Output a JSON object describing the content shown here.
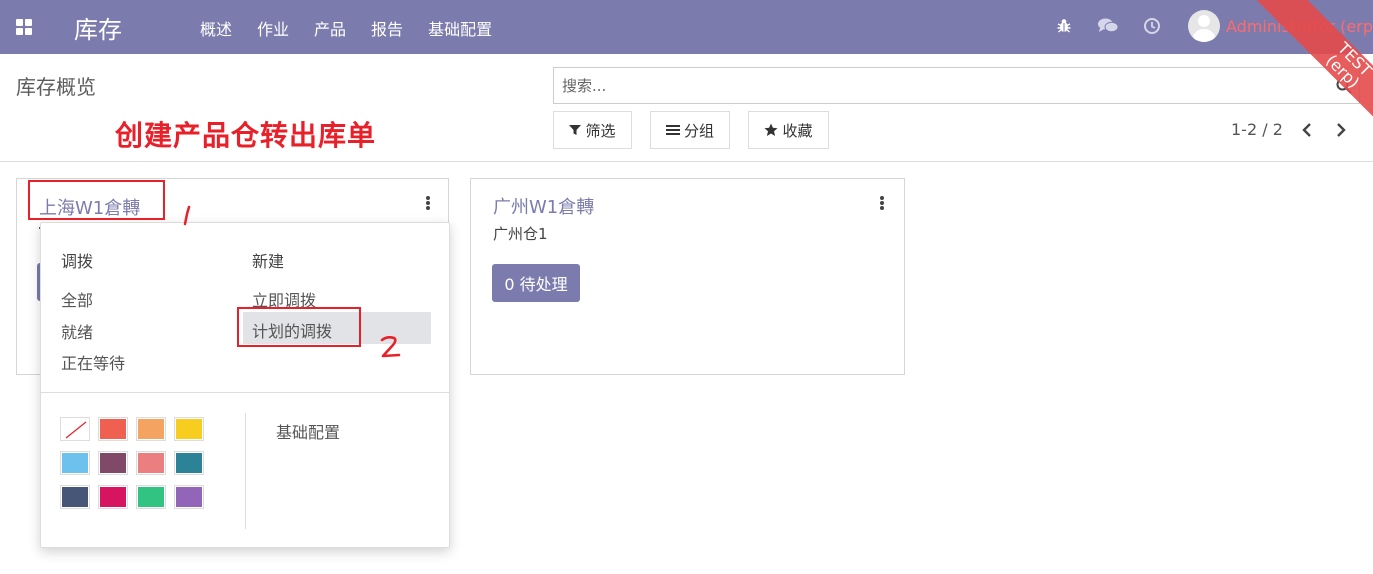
{
  "navbar": {
    "brand": "库存",
    "menu": [
      "概述",
      "作业",
      "产品",
      "报告",
      "基础配置"
    ],
    "icons": [
      "bug-icon",
      "chat-icon",
      "clock-icon"
    ],
    "user": "Administrator (erp)"
  },
  "ribbon": {
    "line1": "TEST",
    "line2": "(erp)"
  },
  "control_panel": {
    "breadcrumb": "库存概览",
    "annotation_title": "创建产品仓转出库单",
    "search_placeholder": "搜索...",
    "filter_label": "筛选",
    "group_label": "分组",
    "favorites_label": "收藏",
    "pager": "1-2 / 2"
  },
  "cards": [
    {
      "title": "上海W1倉轉"
    },
    {
      "title": "广州W1倉轉",
      "subtitle": "广州仓1",
      "button": "0 待处理"
    }
  ],
  "dropdown": {
    "col1_header": "调拨",
    "col1_items": [
      "全部",
      "就绪",
      "正在等待"
    ],
    "col2_header": "新建",
    "col2_items": [
      "立即调拨",
      "计划的调拨"
    ],
    "settings_label": "基础配置",
    "colors": [
      "none",
      "#f06050",
      "#f4a460",
      "#f7cd1f",
      "#6cc1ed",
      "#814968",
      "#eb7e7f",
      "#2c8397",
      "#475577",
      "#d6145f",
      "#30c381",
      "#9365b8"
    ]
  },
  "annotations": {
    "mark1": "1",
    "mark2": "2"
  },
  "colors": {
    "navbar": "#7c7bad",
    "annotation": "#e8202a",
    "ribbon": "#e44a4a"
  }
}
